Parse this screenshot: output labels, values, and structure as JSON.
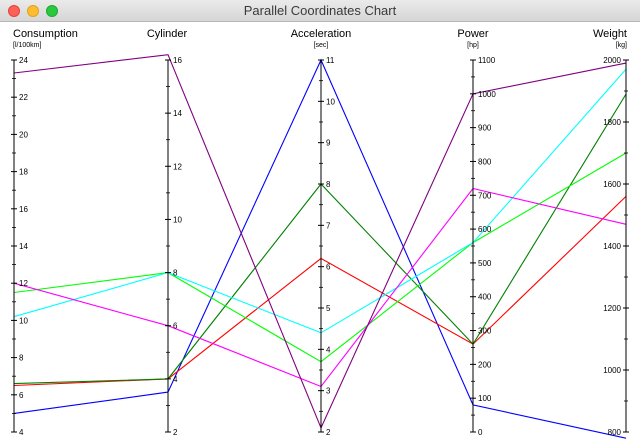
{
  "window": {
    "title": "Parallel Coordinates Chart"
  },
  "chart_data": {
    "type": "parallel-coordinates",
    "dimensions": [
      {
        "name": "Consumption",
        "unit": "[l/100km]",
        "min": 4,
        "max": 24,
        "ticks": [
          4,
          6,
          8,
          10,
          12,
          14,
          16,
          18,
          20,
          22,
          24
        ]
      },
      {
        "name": "Cylinder",
        "unit": "",
        "min": 2,
        "max": 16,
        "ticks": [
          2,
          4,
          6,
          8,
          10,
          12,
          14,
          16
        ]
      },
      {
        "name": "Acceleration",
        "unit": "[sec]",
        "min": 2,
        "max": 11,
        "ticks": [
          2,
          3,
          4,
          5,
          6,
          7,
          8,
          9,
          10,
          11
        ]
      },
      {
        "name": "Power",
        "unit": "[hp]",
        "min": 0,
        "max": 1100,
        "ticks": [
          0,
          100,
          200,
          300,
          400,
          500,
          600,
          700,
          800,
          900,
          1000,
          1100
        ]
      },
      {
        "name": "Weight",
        "unit": "[kg]",
        "min": 800,
        "max": 2000,
        "ticks": [
          800,
          1000,
          1200,
          1400,
          1600,
          1800,
          2000
        ]
      }
    ],
    "series": [
      {
        "color": "#0000ff",
        "values": [
          5.0,
          3.5,
          11,
          80,
          780
        ]
      },
      {
        "color": "#ff0000",
        "values": [
          6.5,
          4,
          6.2,
          260,
          1560
        ]
      },
      {
        "color": "#008000",
        "values": [
          6.6,
          4,
          8,
          260,
          1890
        ]
      },
      {
        "color": "#00ff00",
        "values": [
          11.5,
          8,
          3.7,
          560,
          1700
        ]
      },
      {
        "color": "#00ffff",
        "values": [
          10.2,
          8,
          4.4,
          560,
          1970
        ]
      },
      {
        "color": "#ff00ff",
        "values": [
          12,
          6,
          3.1,
          720,
          1470
        ]
      },
      {
        "color": "#800080",
        "values": [
          23.3,
          16.2,
          2.1,
          1000,
          1990
        ]
      }
    ]
  }
}
